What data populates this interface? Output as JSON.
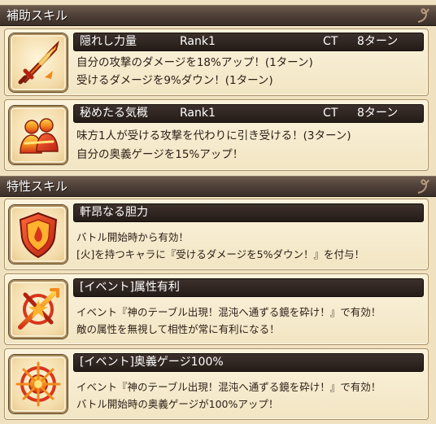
{
  "sections": {
    "support": {
      "title": "補助スキル"
    },
    "trait": {
      "title": "特性スキル"
    }
  },
  "support_skills": [
    {
      "icon": "flaming-sword-icon",
      "name": "隠れし力量",
      "rank": "Rank1",
      "ct_label": "CT",
      "ct_value": "8ターン",
      "lines": [
        "自分の攻撃のダメージを18%アップ！(1ターン)",
        "受けるダメージを9%ダウン！(1ターン)"
      ]
    },
    {
      "icon": "ally-guard-icon",
      "name": "秘めたる気概",
      "rank": "Rank1",
      "ct_label": "CT",
      "ct_value": "8ターン",
      "lines": [
        "味方1人が受ける攻撃を代わりに引き受ける！(3ターン)",
        "自分の奥義ゲージを15%アップ！"
      ]
    }
  ],
  "trait_skills": [
    {
      "icon": "fire-shield-icon",
      "name": "軒昂なる胆力",
      "lines": [
        "バトル開始時から有効！",
        "[火]を持つキャラに『受けるダメージを5%ダウン！』を付与！"
      ]
    },
    {
      "icon": "element-advantage-icon",
      "name": "[イベント]属性有利",
      "lines": [
        "イベント『神のテーブル出現！混沌へ通ずる鏡を砕け！』で有効！",
        "敵の属性を無視して相性が常に有利になる！"
      ]
    },
    {
      "icon": "ougi-gauge-icon",
      "name": "[イベント]奥義ゲージ100%",
      "lines": [
        "イベント『神のテーブル出現！混沌へ通ずる鏡を砕け！』で有効！",
        "バトル開始時の奥義ゲージが100%アップ！"
      ]
    }
  ],
  "colors": {
    "section_bar": "#4a3c34",
    "card_bg": "#f5e9ca",
    "name_bar": "#2c2320",
    "icon_red": "#d8361c",
    "icon_orange": "#f29a1e"
  }
}
